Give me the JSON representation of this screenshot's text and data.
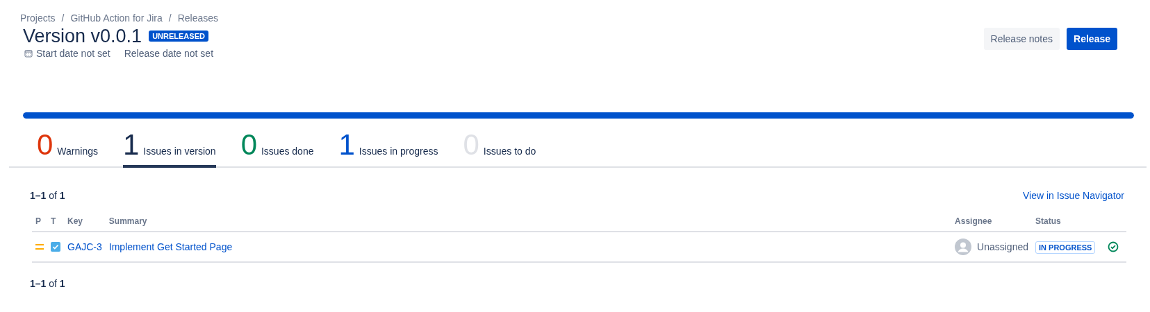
{
  "breadcrumbs": [
    "Projects",
    "GitHub Action for Jira",
    "Releases"
  ],
  "breadcrumb_separator": "/",
  "title": "Version v0.0.1",
  "badge": "UNRELEASED",
  "dates": {
    "start": "Start date not set",
    "release": "Release date not set"
  },
  "buttons": [
    {
      "label": "Release notes",
      "kind": "secondary"
    },
    {
      "label": "Release",
      "kind": "primary"
    }
  ],
  "progress": {
    "level": 1
  },
  "tabs": [
    {
      "count": "0",
      "label": "Warnings",
      "color": "#de350b",
      "selected": false
    },
    {
      "count": "1",
      "label": "Issues in version",
      "color": "#172b4d",
      "selected": true
    },
    {
      "count": "0",
      "label": "Issues done",
      "color": "#00875a",
      "selected": false
    },
    {
      "count": "1",
      "label": "Issues in progress",
      "color": "#0052cc",
      "selected": false
    },
    {
      "count": "0",
      "label": "Issues to do",
      "color": "#dfe1e6",
      "selected": false
    }
  ],
  "pagination_top": "**1–1** of **1**",
  "navigator_link": "View in Issue Navigator",
  "table": {
    "columns": [
      "P",
      "T",
      "Key",
      "Summary",
      "Assignee",
      "Status"
    ],
    "rows": [
      {
        "priority": {
          "kind": "medium"
        },
        "issue_type": {
          "kind": "task"
        },
        "key": "GAJC-3",
        "summary": "Implement Get Started Page",
        "assignee": "Unassigned",
        "status": "IN PROGRESS",
        "resolved": true
      }
    ]
  },
  "pagination_bottom": "**1–1** of **1**"
}
